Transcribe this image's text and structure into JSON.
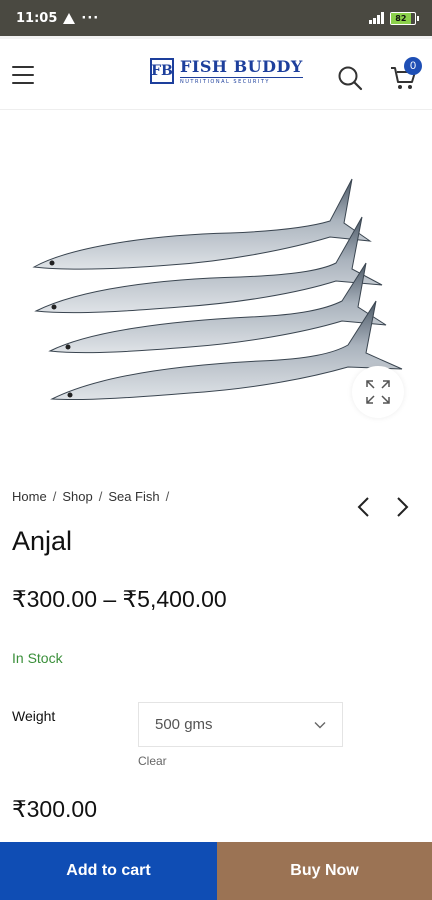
{
  "status_bar": {
    "time": "11:05",
    "dots": "···",
    "battery": "82"
  },
  "header": {
    "logo_mark": "FB",
    "logo_name": "FISH BUDDY",
    "logo_tagline": "NUTRITIONAL SECURITY",
    "cart_count": "0"
  },
  "colors": {
    "brand_blue": "#0f4db4",
    "buy_brown": "#9b7354",
    "in_stock_green": "#3a8f3a"
  },
  "breadcrumb": {
    "home": "Home",
    "shop": "Shop",
    "category": "Sea Fish",
    "sep": "/"
  },
  "product": {
    "title": "Anjal",
    "price_range": "₹300.00 – ₹5,400.00",
    "stock_status": "In Stock",
    "weight_label": "Weight",
    "weight_selected": "500 gms",
    "clear_label": "Clear",
    "current_price": "₹300.00"
  },
  "actions": {
    "add_to_cart": "Add to cart",
    "buy_now": "Buy Now"
  },
  "icons": [
    "warning-icon",
    "signal-icon",
    "battery-icon",
    "hamburger-menu-icon",
    "search-icon",
    "cart-icon",
    "expand-icon",
    "chevron-left-icon",
    "chevron-right-icon",
    "chevron-down-icon"
  ]
}
